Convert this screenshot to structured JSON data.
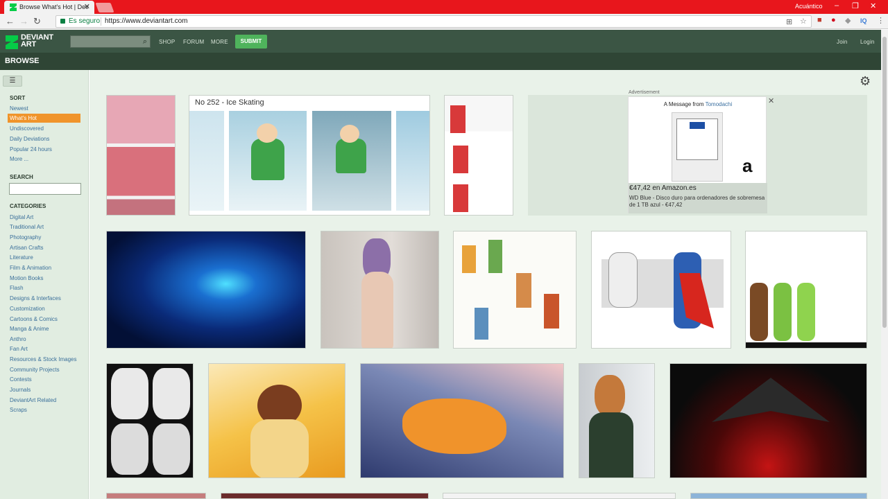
{
  "browser": {
    "tab_title": "Browse What's Hot | Dev",
    "profile": "Acuántico",
    "security": "Es seguro",
    "url": "https://www.deviantart.com"
  },
  "header": {
    "logo_line1": "DEVIANT",
    "logo_line2": "ART",
    "nav": [
      "SHOP",
      "FORUM",
      "MORE"
    ],
    "submit": "SUBMIT",
    "join": "Join",
    "login": "Login"
  },
  "browse_title": "BROWSE",
  "sidebar": {
    "sort_heading": "SORT",
    "sort_items": [
      "Newest",
      "What's Hot",
      "Undiscovered",
      "Daily Deviations",
      "Popular 24 hours",
      "More ..."
    ],
    "search_heading": "SEARCH",
    "categories_heading": "CATEGORIES",
    "categories": [
      "Digital Art",
      "Traditional Art",
      "Photography",
      "Artisan Crafts",
      "Literature",
      "Film & Animation",
      "Motion Books",
      "Flash",
      "Designs & Interfaces",
      "Customization",
      "Cartoons & Comics",
      "Manga & Anime",
      "Anthro",
      "Fan Art",
      "Resources & Stock Images",
      "Community Projects",
      "Contests",
      "Journals",
      "DeviantArt Related",
      "Scraps"
    ]
  },
  "main": {
    "strip_title": "No 252 - Ice Skating",
    "ad": {
      "label": "Advertisement",
      "message_prefix": "A Message from",
      "message_brand": "Tomodachi",
      "price": "€47,42 en Amazon.es",
      "desc": "WD Blue - Disco duro para ordenadores de sobremesa de 1 TB azul - €47,42",
      "logo": "a"
    }
  },
  "colors": {
    "accent": "#f0942b",
    "header": "#3b5544",
    "submit": "#4fb35c"
  }
}
